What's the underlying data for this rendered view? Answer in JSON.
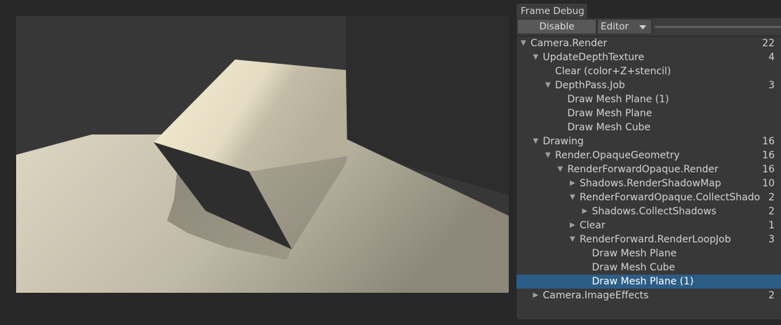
{
  "frame_debug": {
    "tab_title": "Frame Debug",
    "toolbar": {
      "disable_label": "Disable",
      "target_value": "Editor",
      "target_caret_icon": "chevron-down-icon"
    },
    "tree": [
      {
        "label": "Camera.Render",
        "count": "22",
        "depth": 0,
        "expander": "expanded"
      },
      {
        "label": "UpdateDepthTexture",
        "count": "4",
        "depth": 1,
        "expander": "expanded"
      },
      {
        "label": "Clear (color+Z+stencil)",
        "count": "",
        "depth": 2,
        "expander": "none"
      },
      {
        "label": "DepthPass.Job",
        "count": "3",
        "depth": 2,
        "expander": "expanded"
      },
      {
        "label": "Draw Mesh Plane (1)",
        "count": "",
        "depth": 3,
        "expander": "none"
      },
      {
        "label": "Draw Mesh Plane",
        "count": "",
        "depth": 3,
        "expander": "none"
      },
      {
        "label": "Draw Mesh Cube",
        "count": "",
        "depth": 3,
        "expander": "none"
      },
      {
        "label": "Drawing",
        "count": "16",
        "depth": 1,
        "expander": "expanded"
      },
      {
        "label": "Render.OpaqueGeometry",
        "count": "16",
        "depth": 2,
        "expander": "expanded"
      },
      {
        "label": "RenderForwardOpaque.Render",
        "count": "16",
        "depth": 3,
        "expander": "expanded"
      },
      {
        "label": "Shadows.RenderShadowMap",
        "count": "10",
        "depth": 4,
        "expander": "collapsed"
      },
      {
        "label": "RenderForwardOpaque.CollectShado",
        "count": "2",
        "depth": 4,
        "expander": "expanded"
      },
      {
        "label": "Shadows.CollectShadows",
        "count": "2",
        "depth": 5,
        "expander": "collapsed"
      },
      {
        "label": "Clear",
        "count": "1",
        "depth": 4,
        "expander": "collapsed"
      },
      {
        "label": "RenderForward.RenderLoopJob",
        "count": "3",
        "depth": 4,
        "expander": "expanded"
      },
      {
        "label": "Draw Mesh Plane",
        "count": "",
        "depth": 5,
        "expander": "none"
      },
      {
        "label": "Draw Mesh Cube",
        "count": "",
        "depth": 5,
        "expander": "none"
      },
      {
        "label": "Draw Mesh Plane (1)",
        "count": "",
        "depth": 5,
        "expander": "none",
        "selected": true
      },
      {
        "label": "Camera.ImageEffects",
        "count": "2",
        "depth": 1,
        "expander": "collapsed"
      }
    ]
  },
  "colors": {
    "selection": "#2c5d87",
    "panel_background": "#383838",
    "scene_background": "#363636",
    "floor_color": "#dcd6c3",
    "cube_lit_face": "#ece5cc"
  }
}
